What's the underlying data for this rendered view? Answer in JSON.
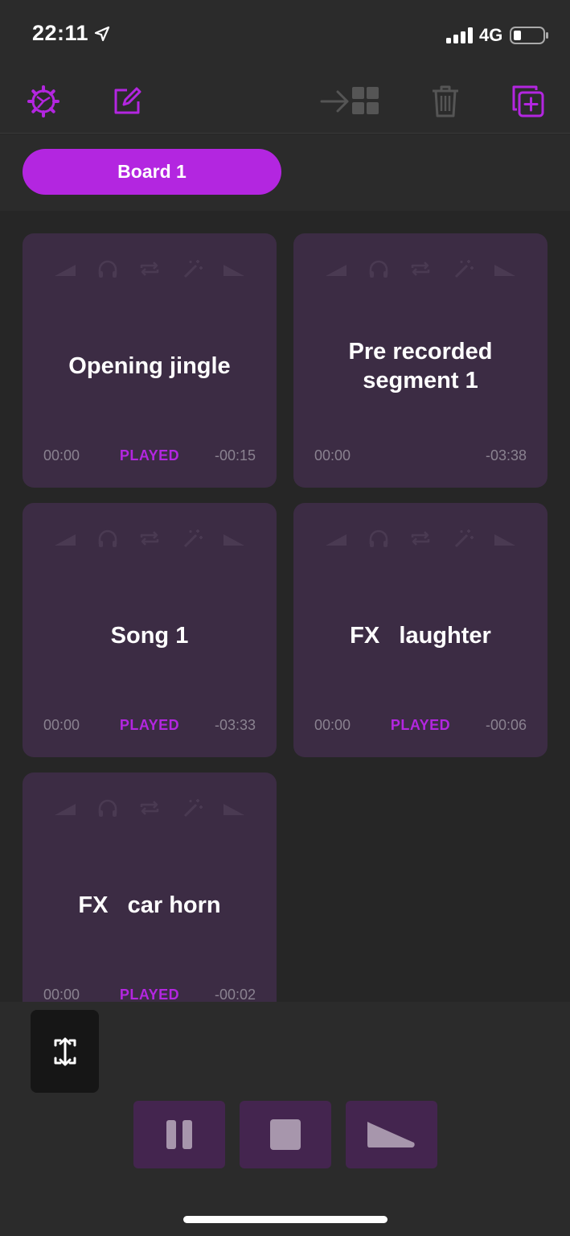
{
  "status_bar": {
    "time": "22:11",
    "network": "4G",
    "icons": [
      "location-arrow-icon",
      "signal-bars-icon",
      "battery-icon"
    ]
  },
  "toolbar": {
    "icons": [
      "settings-gear-icon",
      "edit-icon",
      "move-to-board-icon",
      "trash-icon",
      "add-board-icon"
    ],
    "accent_color": "#b326e0",
    "disabled_color": "#555555"
  },
  "board": {
    "active_tab": "Board 1"
  },
  "tiles": [
    {
      "title": "Opening jingle",
      "elapsed": "00:00",
      "status": "PLAYED",
      "remaining": "-00:15"
    },
    {
      "title": "Pre recorded\nsegment 1",
      "elapsed": "00:00",
      "status": "",
      "remaining": "-03:38"
    },
    {
      "title": "Song 1",
      "elapsed": "00:00",
      "status": "PLAYED",
      "remaining": "-03:33"
    },
    {
      "title": "FX   laughter",
      "elapsed": "00:00",
      "status": "PLAYED",
      "remaining": "-00:06"
    },
    {
      "title": "FX   car horn",
      "elapsed": "00:00",
      "status": "PLAYED",
      "remaining": "-00:02"
    }
  ],
  "tile_option_icons": [
    "fade-in-icon",
    "headphones-icon",
    "loop-icon",
    "effects-wand-icon",
    "fade-out-icon"
  ],
  "controls": {
    "icons": [
      "fit-screen-icon",
      "pause-icon",
      "stop-icon",
      "fade-out-icon"
    ]
  }
}
